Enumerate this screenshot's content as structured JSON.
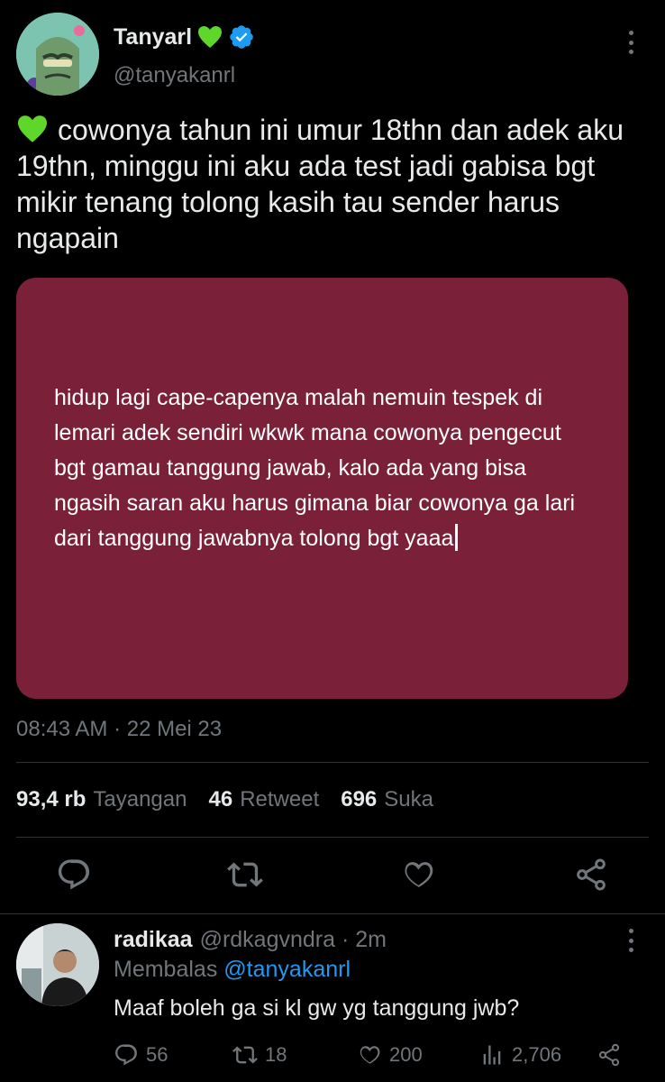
{
  "tweet": {
    "display_name": "Tanyarl",
    "handle": "@tanyakanrl",
    "text": "cowonya tahun ini umur 18thn dan adek aku 19thn, minggu ini aku ada test jadi gabisa bgt mikir tenang tolong kasih tau sender harus ngapain",
    "media_text": "hidup lagi cape-capenya malah nemuin tespek di lemari adek sendiri wkwk mana cowonya pengecut bgt gamau tanggung jawab, kalo ada yang bisa ngasih saran aku harus gimana biar cowonya ga lari dari tanggung jawabnya tolong bgt yaaa",
    "timestamp": "08:43 AM · 22 Mei 23",
    "stats": {
      "views_count": "93,4 rb",
      "views_label": "Tayangan",
      "retweets_count": "46",
      "retweets_label": "Retweet",
      "likes_count": "696",
      "likes_label": "Suka"
    }
  },
  "reply": {
    "display_name": "radikaa",
    "handle_time": "@rdkagvndra · 2m",
    "replying_prefix": "Membalas",
    "replying_to": "@tanyakanrl",
    "text": "Maaf boleh ga si kl gw yg tanggung jwb?",
    "counts": {
      "replies": "56",
      "retweets": "18",
      "likes": "200",
      "views": "2,706"
    }
  },
  "colors": {
    "background": "#000000",
    "media_card": "#7a2038",
    "verified": "#1d9bf0",
    "heart_emoji": "#5ed62a",
    "muted_text": "#71767b",
    "link": "#1d9bf0"
  },
  "icons": [
    "green-heart-icon",
    "verified-badge-icon",
    "more-icon",
    "reply-icon",
    "retweet-icon",
    "like-icon",
    "share-icon",
    "views-icon"
  ]
}
